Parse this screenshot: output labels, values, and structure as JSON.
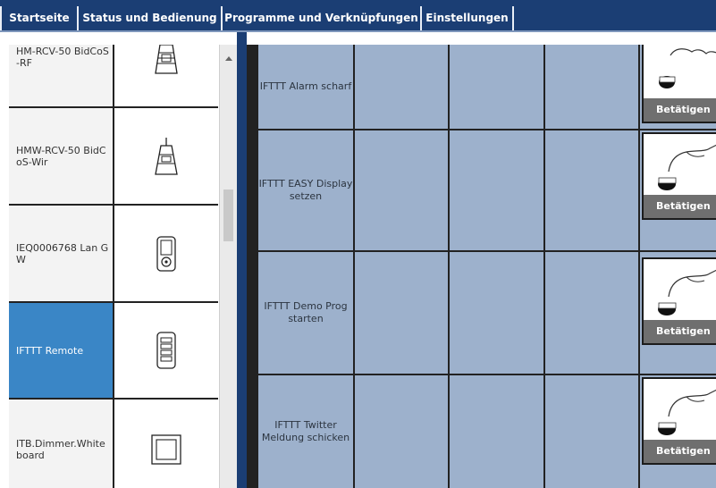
{
  "nav": {
    "tabs": [
      {
        "label": "Startseite"
      },
      {
        "label": "Status und Bedienung"
      },
      {
        "label": "Programme und Verknüpfungen"
      },
      {
        "label": "Einstellungen"
      }
    ]
  },
  "devices": [
    {
      "name": "HM-RCV-50 BidCoS-RF",
      "icon": "receiver-icon",
      "selected": false
    },
    {
      "name": "HMW-RCV-50 BidCoS-Wir",
      "icon": "receiver-antenna-icon",
      "selected": false
    },
    {
      "name": "IEQ0006768 Lan GW",
      "icon": "lan-gateway-icon",
      "selected": false
    },
    {
      "name": "IFTTT Remote",
      "icon": "remote-icon",
      "selected": true
    },
    {
      "name": "ITB.Dimmer.Whiteboard",
      "icon": "wall-switch-icon",
      "selected": false
    }
  ],
  "programs": [
    {
      "name": "IFTTT Alarm scharf",
      "action_label": "Betätigen"
    },
    {
      "name": "IFTTT EASY Display setzen",
      "action_label": "Betätigen"
    },
    {
      "name": "IFTTT Demo Prog starten",
      "action_label": "Betätigen"
    },
    {
      "name": "IFTTT Twitter Meldung schicken",
      "action_label": "Betätigen"
    }
  ],
  "icons": {
    "action_button": "hand-press-button-icon",
    "scroll_up": "arrow-up-icon"
  },
  "colors": {
    "nav_bg": "#1b3e74",
    "selected_row": "#3a86c6",
    "grid_cell": "#9db1cc",
    "action_label_bg": "#6f6f6f"
  }
}
